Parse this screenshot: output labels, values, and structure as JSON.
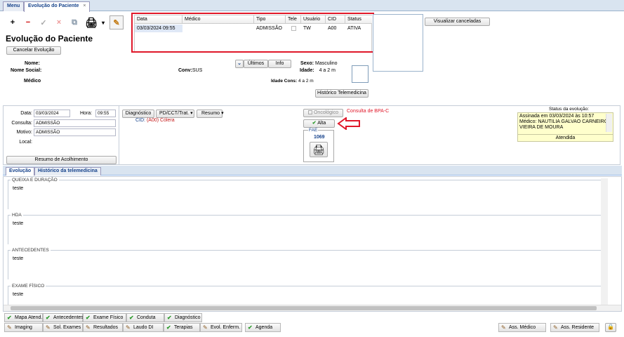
{
  "tabs": [
    {
      "label": "Menu"
    },
    {
      "label": "Evolução do Paciente",
      "close": "×"
    }
  ],
  "toolbar": {
    "add": "+",
    "remove": "−",
    "confirm": "✓",
    "cancel": "×",
    "copy": "⧉",
    "print": "🖨",
    "dropdown": "▾",
    "edit": "✎"
  },
  "page_title": "Evolução do Paciente",
  "cancel_evolution": "Cancelar Evolução",
  "grid": {
    "headers": [
      "Data",
      "Médico",
      "Tipo",
      "Tele",
      "Usuário",
      "CID",
      "Status"
    ],
    "rows": [
      {
        "data": "03/03/2024 09:55",
        "medico": "",
        "tipo": "ADMISSÃO",
        "tele": "",
        "usuario": "TW",
        "cid": "A00",
        "status": "ATIVA"
      }
    ]
  },
  "view_canceled": "Visualizar canceladas",
  "patient": {
    "nome_label": "Nome:",
    "nome_social_label": "Nome Social:",
    "medico_label": "Médico",
    "conv_label": "Conv:",
    "conv_value": "SUS",
    "sexo_label": "Sexo:",
    "sexo_value": "Masculino",
    "idade_label": "Idade:",
    "idade_value": "4 a 2 m",
    "idade_cons_label": "Idade Cons:",
    "idade_cons_value": "4 a 2 m",
    "ultimos": "Últimos",
    "info": "Info",
    "historico_tele": "Histórico Telemedicina"
  },
  "form": {
    "data_label": "Data:",
    "data_value": "03/03/2024",
    "hora_label": "Hora:",
    "hora_value": "09:55",
    "consulta_label": "Consulta:",
    "consulta_value": "ADMISSÃO",
    "motivo_label": "Motivo:",
    "motivo_value": "ADMISSÃO",
    "local_label": "Local:",
    "resumo_acolhimento": "Resumo de Acolhimento"
  },
  "actions": {
    "diagnostico": "Diagnóstico",
    "pd": "PD/CCT/Trat.",
    "resumo": "Resumo",
    "cid_label": "CID:",
    "cid_value": "(A00) Cólera",
    "oncologico": "Oncológico",
    "consulta_bpa": "Consulta de BPA-C",
    "alta": "Alta",
    "fae_label": "FAE",
    "fae_number": "1069"
  },
  "status_box": {
    "title": "Status da evolução:",
    "line1": "Assinada em 03/03/2024 às 10:57",
    "line2": "Médico: NAUTILIA GALVAO CARNEIRO",
    "line3": "VIEIRA DE MOURA",
    "footer": "Atendida"
  },
  "content_tabs": [
    {
      "label": "Evolução"
    },
    {
      "label": "Histórico da telemedicina"
    }
  ],
  "sections": [
    {
      "title": "QUEIXA E DURAÇÃO",
      "text": "teste"
    },
    {
      "title": "HDA",
      "text": "teste"
    },
    {
      "title": "ANTECEDENTES",
      "text": "teste"
    },
    {
      "title": "EXAME FÍSICO",
      "text": "teste"
    }
  ],
  "bottom_row1": [
    {
      "label": "Mapa Atend."
    },
    {
      "label": "Antecedentes"
    },
    {
      "label": "Exame Físico"
    },
    {
      "label": "Conduta"
    },
    {
      "label": "Diagnóstico"
    }
  ],
  "bottom_row2": [
    {
      "label": "Imaging"
    },
    {
      "label": "Sol. Exames"
    },
    {
      "label": "Resultados"
    },
    {
      "label": "Laudo DI"
    },
    {
      "label": "Terapias"
    },
    {
      "label": "Evol. Enferm."
    },
    {
      "label": "Agenda"
    }
  ],
  "bottom_right": [
    {
      "label": "Ass. Médico"
    },
    {
      "label": "Ass. Residente"
    }
  ],
  "icons": {
    "arrow": "red-arrow-icon",
    "lock": "lock-icon"
  },
  "colors": {
    "highlight": "#e0182a",
    "link_red": "#e0182a",
    "status_bg": "#ffffcc"
  }
}
